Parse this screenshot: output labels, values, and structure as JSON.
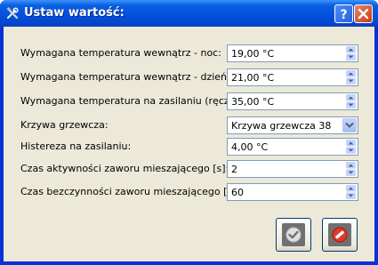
{
  "window": {
    "title": "Ustaw wartość:",
    "icons": {
      "app": "tools-icon",
      "help": "help-icon",
      "close": "close-icon"
    }
  },
  "fields": [
    {
      "label": "Wymagana temperatura wewnątrz - noc:",
      "value": "19,00 °C",
      "control": "spinner"
    },
    {
      "label": "Wymagana temperatura wewnątrz - dzień:",
      "value": "21,00 °C",
      "control": "spinner"
    },
    {
      "label": "Wymagana temperatura na zasilaniu (ręczny):",
      "value": "35,00 °C",
      "control": "spinner"
    },
    {
      "label": "Krzywa grzewcza:",
      "value": "Krzywa grzewcza 38",
      "control": "dropdown"
    },
    {
      "label": "Histereza na zasilaniu:",
      "value": "4,00 °C",
      "control": "spinner"
    },
    {
      "label": "Czas aktywności zaworu mieszającego [s]:",
      "value": "2",
      "control": "spinner"
    },
    {
      "label": "Czas bezczynności zaworu mieszającego [s]:",
      "value": "60",
      "control": "spinner"
    }
  ],
  "buttons": {
    "ok_icon": "checkmark-icon",
    "cancel_icon": "cancel-icon"
  },
  "colors": {
    "titlebar": "#0553de",
    "client_bg": "#ece9d8",
    "field_border": "#7f9db9",
    "close_button": "#c8391a"
  }
}
